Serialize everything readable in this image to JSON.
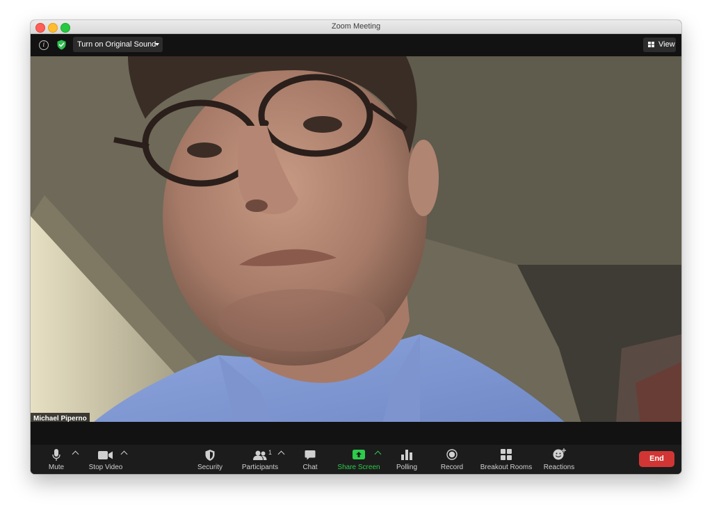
{
  "window": {
    "title": "Zoom Meeting"
  },
  "topbar": {
    "original_sound_label": "Turn on Original Sound",
    "view_label": "View"
  },
  "video": {
    "participant_name": "Michael Piperno"
  },
  "toolbar": {
    "mute": "Mute",
    "stop_video": "Stop Video",
    "security": "Security",
    "participants": "Participants",
    "participant_count": "1",
    "chat": "Chat",
    "share_screen": "Share Screen",
    "polling": "Polling",
    "record": "Record",
    "breakout_rooms": "Breakout Rooms",
    "reactions": "Reactions",
    "end": "End"
  },
  "colors": {
    "share_screen_accent": "#2dcb4a",
    "end_button": "#d13634",
    "toolbar_bg": "#1c1c1c"
  },
  "icons": [
    "info-icon",
    "shield-check-icon",
    "caret-down-icon",
    "grid-view-icon",
    "microphone-icon",
    "camera-icon",
    "security-shield-icon",
    "participants-icon",
    "chat-bubble-icon",
    "share-screen-icon",
    "polling-icon",
    "record-icon",
    "breakout-rooms-icon",
    "reactions-icon"
  ]
}
